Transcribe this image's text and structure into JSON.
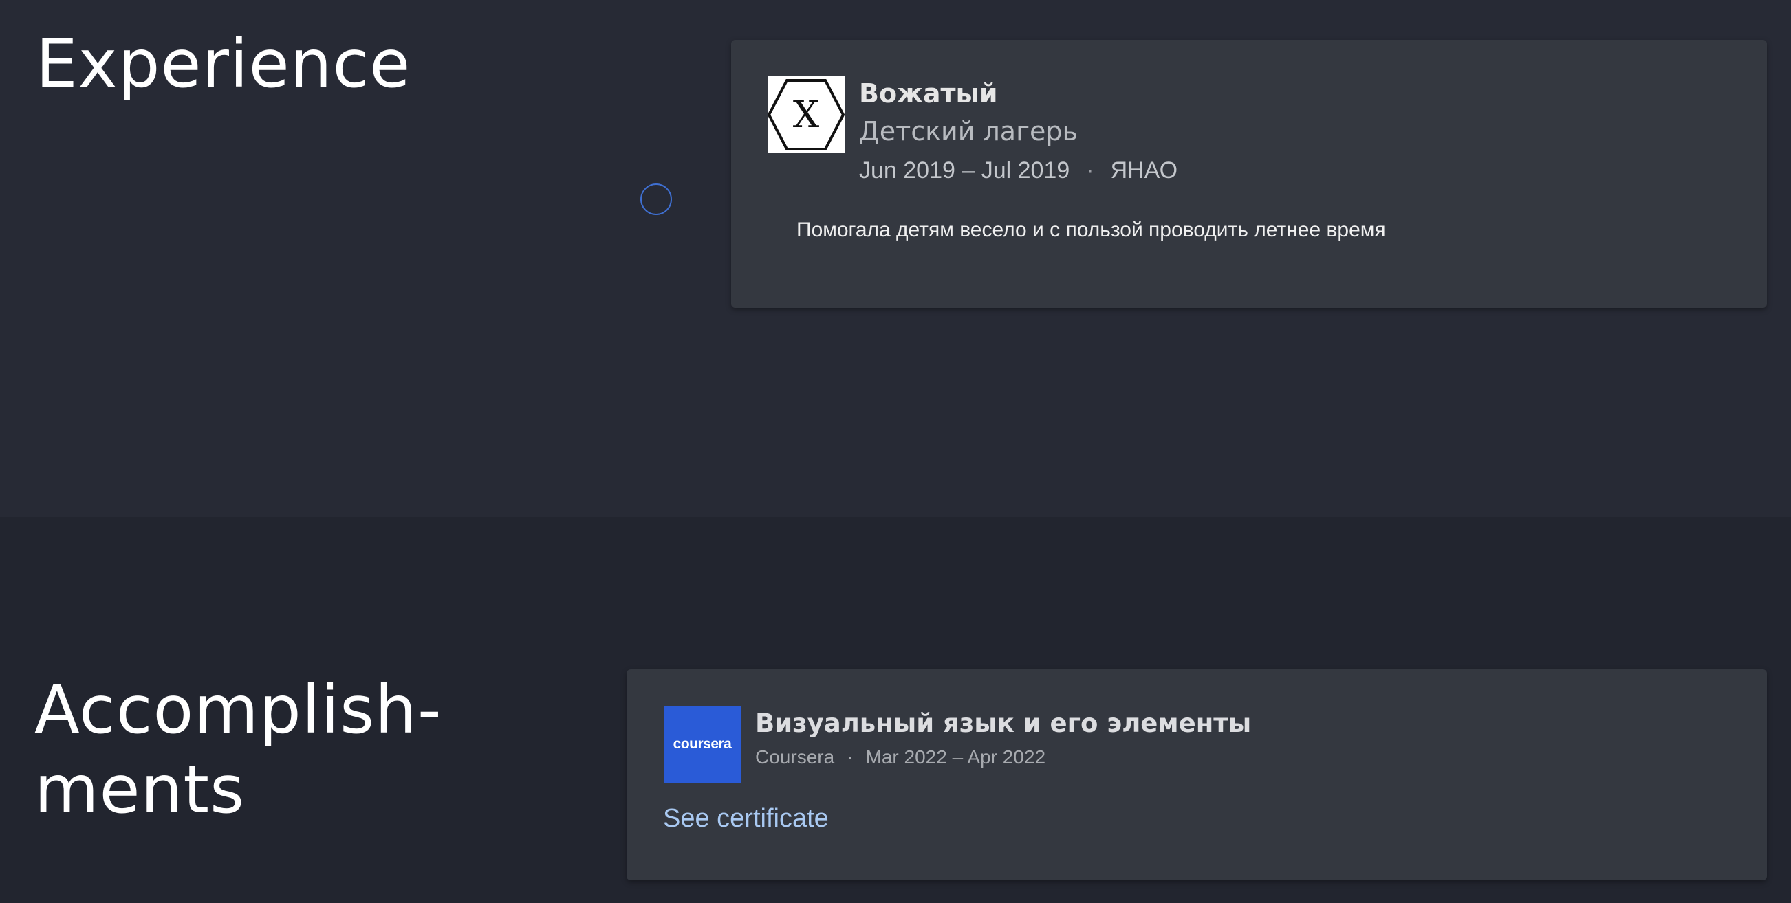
{
  "experience": {
    "section_title": "Experience",
    "items": [
      {
        "logo_icon": "x-hexagon-logo-icon",
        "logo_letter": "X",
        "title": "Вожатый",
        "company": "Детский лагерь",
        "dates": "Jun 2019 – Jul 2019",
        "separator": "·",
        "location": "ЯНАО",
        "description": "Помогала детям весело и с пользой проводить летнее время"
      }
    ],
    "timeline_dot_color": "#3f6fd1"
  },
  "accomplishments": {
    "section_title": "Accomplish-\nments",
    "items": [
      {
        "logo_icon": "coursera-logo-icon",
        "logo_text": "coursera",
        "logo_color": "#2a5bd7",
        "title": "Визуальный язык и его элементы",
        "issuer": "Coursera",
        "separator": "·",
        "dates": "Mar 2022 – Apr 2022",
        "link_label": "See certificate"
      }
    ]
  },
  "colors": {
    "background_top": "#272a35",
    "background_bottom": "#22252f",
    "card": "#343840",
    "link": "#a9c9f2"
  }
}
